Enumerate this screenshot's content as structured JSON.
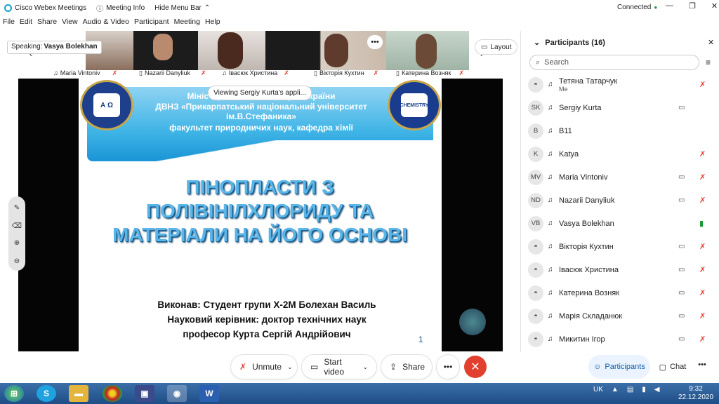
{
  "titlebar": {
    "app": "Cisco Webex Meetings",
    "meeting_info": "Meeting Info",
    "hide_menu": "Hide Menu Bar",
    "status": "Connected"
  },
  "menu": [
    "File",
    "Edit",
    "Share",
    "View",
    "Audio & Video",
    "Participant",
    "Meeting",
    "Help"
  ],
  "speaking": {
    "label": "Speaking:",
    "name": "Vasya Bolekhan"
  },
  "video_tiles": [
    {
      "name": "Maria Vintoniv"
    },
    {
      "name": "Nazarii Danyliuk"
    },
    {
      "name": "Івасюк Христина"
    },
    {
      "name": "Вікторія Кухтин"
    },
    {
      "name": "Катерина Возняк"
    }
  ],
  "layout_label": "Layout",
  "viewing_tip": "Viewing Sergiy Kurta's appli...",
  "slide": {
    "header_line1": "Міністерство освіти і науки України",
    "header_line2": "ДВНЗ «Прикарпатський національний університет",
    "header_line3": "ім.В.Стефаника»",
    "header_line4": "факультет природничих наук,   кафедра хімії",
    "seal_left": "А Ω",
    "seal_right": "CHEMISTRY",
    "title_1": "ПІНОПЛАСТИ З",
    "title_2": "ПОЛІВІНІЛХЛОРИДУ ТА",
    "title_3": "МАТЕРІАЛИ НА ЙОГО ОСНОВІ",
    "credit_1": "Виконав: Студент групи Х-2М Болехан Василь",
    "credit_2": "Науковий керівник: доктор технічних наук",
    "credit_3": "професор Курта Сергій Андрійович",
    "page": "1"
  },
  "controls": {
    "unmute": "Unmute",
    "start_video": "Start video",
    "share": "Share",
    "participants": "Participants",
    "chat": "Chat"
  },
  "panel": {
    "title": "Participants (16)",
    "search_placeholder": "Search",
    "participants": [
      {
        "initials": "",
        "name": "Тетяна Татарчук",
        "sub": "Me",
        "video": false,
        "mic": "muted"
      },
      {
        "initials": "SK",
        "name": "Sergiy Kurta",
        "sub": "",
        "video": true,
        "mic": "none"
      },
      {
        "initials": "B",
        "name": "B11",
        "sub": "",
        "video": false,
        "mic": "none"
      },
      {
        "initials": "K",
        "name": "Katya",
        "sub": "",
        "video": false,
        "mic": "muted"
      },
      {
        "initials": "MV",
        "name": "Maria Vintoniv",
        "sub": "",
        "video": true,
        "mic": "muted"
      },
      {
        "initials": "ND",
        "name": "Nazarii Danyliuk",
        "sub": "",
        "video": true,
        "mic": "muted"
      },
      {
        "initials": "VB",
        "name": "Vasya Bolekhan",
        "sub": "",
        "video": false,
        "mic": "live"
      },
      {
        "initials": "",
        "name": "Вікторія Кухтин",
        "sub": "",
        "video": true,
        "mic": "muted"
      },
      {
        "initials": "",
        "name": "Івасюк Христина",
        "sub": "",
        "video": true,
        "mic": "muted"
      },
      {
        "initials": "",
        "name": "Катерина Возняк",
        "sub": "",
        "video": true,
        "mic": "muted"
      },
      {
        "initials": "",
        "name": "Марія Складанюк",
        "sub": "",
        "video": true,
        "mic": "muted"
      },
      {
        "initials": "",
        "name": "Микитин Ігор",
        "sub": "",
        "video": true,
        "mic": "muted"
      }
    ]
  },
  "taskbar": {
    "lang": "UK",
    "time": "9:32",
    "date": "22.12.2020"
  }
}
